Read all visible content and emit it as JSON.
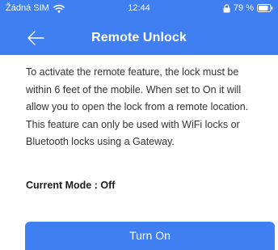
{
  "status_bar": {
    "carrier": "Žádná SIM",
    "time": "12:44",
    "battery_percent": "79 %",
    "icons": [
      "wifi-icon",
      "lock-rotation-icon",
      "battery-icon"
    ]
  },
  "header": {
    "title": "Remote Unlock",
    "back_icon": "arrow-left-icon"
  },
  "main": {
    "description": "To activate the remote feature, the lock must be\nwithin 6 feet of the mobile. When set to On it will\nallow you to open the lock from a remote location.\nThis feature can only be used with WiFi locks or\nBluetooth locks using a Gateway.",
    "current_mode": "Current Mode : Off",
    "button_label": "Turn On"
  },
  "colors": {
    "accent": "#3f7ff1",
    "text": "#333333",
    "background": "#ffffff"
  }
}
